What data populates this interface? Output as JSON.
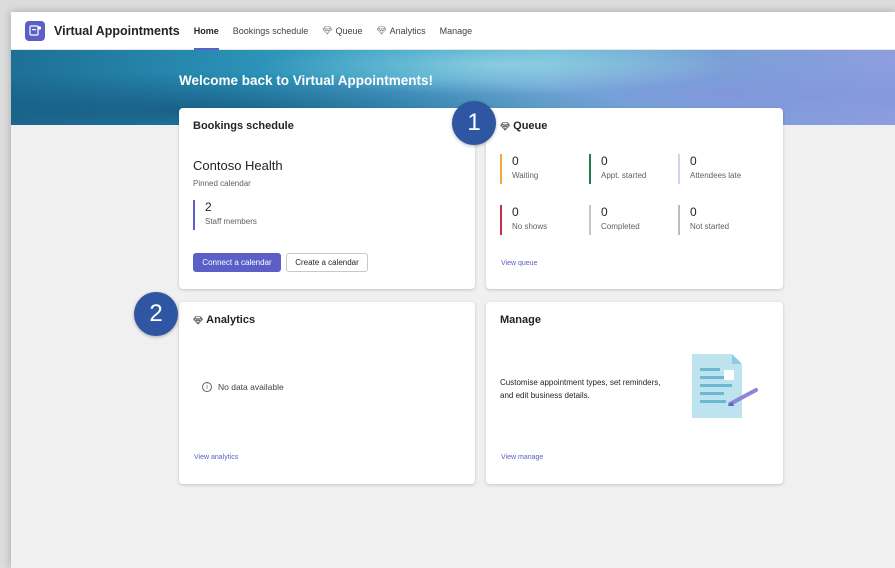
{
  "app": {
    "title": "Virtual Appointments"
  },
  "nav": {
    "tabs": [
      {
        "label": "Home",
        "active": true
      },
      {
        "label": "Bookings schedule"
      },
      {
        "label": "Queue",
        "icon": "gem-icon"
      },
      {
        "label": "Analytics",
        "icon": "gem-icon"
      },
      {
        "label": "Manage"
      }
    ]
  },
  "banner": {
    "title": "Welcome back to Virtual Appointments!"
  },
  "bookings": {
    "title": "Bookings schedule",
    "org_name": "Contoso Health",
    "org_sub": "Pinned calendar",
    "staff_count": "2",
    "staff_label": "Staff members",
    "connect_label": "Connect a calendar",
    "create_label": "Create a calendar"
  },
  "queue": {
    "title": "Queue",
    "stats": [
      {
        "value": "0",
        "label": "Waiting",
        "color": "#f2a93b"
      },
      {
        "value": "0",
        "label": "Appt. started",
        "color": "#237b4b"
      },
      {
        "value": "0",
        "label": "Attendees late",
        "color": "#d1d1f0"
      },
      {
        "value": "0",
        "label": "No shows",
        "color": "#c4314b"
      },
      {
        "value": "0",
        "label": "Completed",
        "color": "#c8c8c8"
      },
      {
        "value": "0",
        "label": "Not started",
        "color": "#bdbdbd"
      }
    ],
    "link": "View queue"
  },
  "analytics": {
    "title": "Analytics",
    "no_data": "No data available",
    "link": "View analytics"
  },
  "manage": {
    "title": "Manage",
    "description": "Customise appointment types, set reminders, and edit business details.",
    "link": "View manage"
  },
  "callouts": [
    "1",
    "2"
  ],
  "colors": {
    "accent": "#5b5fc7",
    "callout": "#2f56a3"
  }
}
